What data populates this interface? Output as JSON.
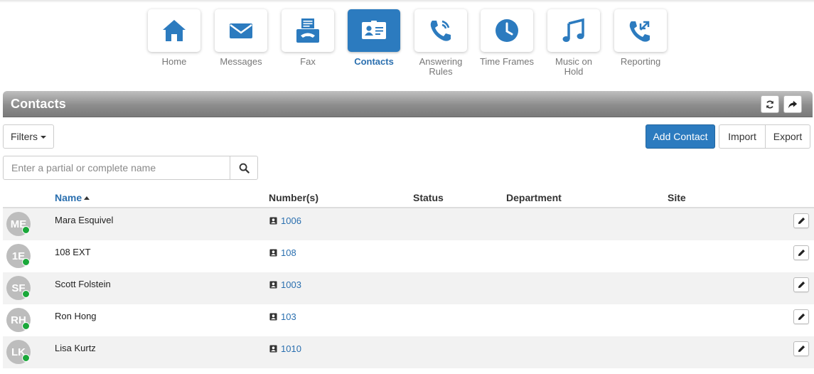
{
  "nav": {
    "items": [
      {
        "label": "Home",
        "icon": "home-icon",
        "active": false
      },
      {
        "label": "Messages",
        "icon": "envelope-icon",
        "active": false
      },
      {
        "label": "Fax",
        "icon": "fax-icon",
        "active": false
      },
      {
        "label": "Contacts",
        "icon": "contact-card-icon",
        "active": true
      },
      {
        "label": "Answering Rules",
        "icon": "phone-rules-icon",
        "active": false
      },
      {
        "label": "Time Frames",
        "icon": "clock-icon",
        "active": false
      },
      {
        "label": "Music on Hold",
        "icon": "music-note-icon",
        "active": false
      },
      {
        "label": "Reporting",
        "icon": "phone-arrows-icon",
        "active": false
      }
    ]
  },
  "panel": {
    "title": "Contacts",
    "refresh_icon": "refresh-icon",
    "share_icon": "share-arrow-icon"
  },
  "toolbar": {
    "filters_label": "Filters",
    "add_contact_label": "Add Contact",
    "import_label": "Import",
    "export_label": "Export"
  },
  "search": {
    "placeholder": "Enter a partial or complete name",
    "value": "",
    "icon": "search-icon"
  },
  "table": {
    "columns": {
      "name": "Name",
      "numbers": "Number(s)",
      "status": "Status",
      "department": "Department",
      "site": "Site"
    },
    "sort": {
      "column": "name",
      "direction": "ascending"
    },
    "rows": [
      {
        "initials": "ME",
        "name": "Mara Esquivel",
        "number": "1006",
        "status": "",
        "department": "",
        "site": ""
      },
      {
        "initials": "1E",
        "name": "108 EXT",
        "number": "108",
        "status": "",
        "department": "",
        "site": ""
      },
      {
        "initials": "SF",
        "name": "Scott Folstein",
        "number": "1003",
        "status": "",
        "department": "",
        "site": ""
      },
      {
        "initials": "RH",
        "name": "Ron Hong",
        "number": "103",
        "status": "",
        "department": "",
        "site": ""
      },
      {
        "initials": "LK",
        "name": "Lisa Kurtz",
        "number": "1010",
        "status": "",
        "department": "",
        "site": ""
      }
    ]
  },
  "colors": {
    "accent": "#2c7bbf",
    "link": "#2a6faf",
    "presence_online": "#1aa83a",
    "avatar_bg": "#bdbdbd",
    "header_gray": "#8d8d8d"
  }
}
